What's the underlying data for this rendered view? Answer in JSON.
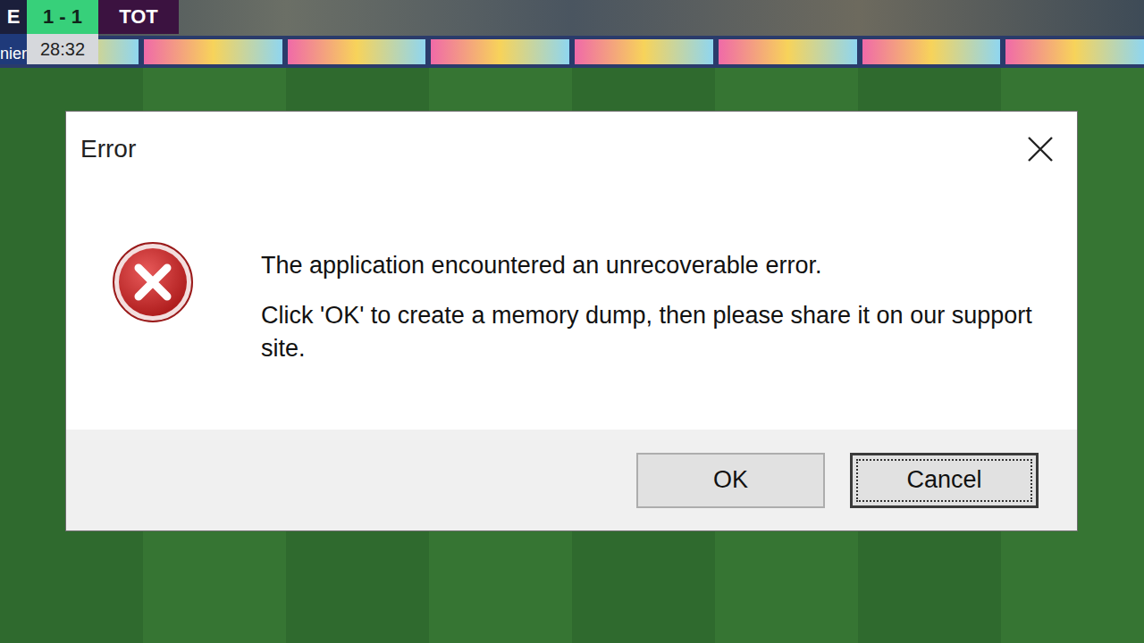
{
  "scoreboard": {
    "home": "E",
    "score": "1 - 1",
    "away": "TOT",
    "clock": "28:32",
    "ticker": "nier"
  },
  "dialog": {
    "title": "Error",
    "message": "The application encountered an unrecoverable error.",
    "detail": "Click 'OK' to create a memory dump, then please share it on our support site.",
    "buttons": [
      {
        "label": "OK",
        "focused": false
      },
      {
        "label": "Cancel",
        "focused": true
      }
    ]
  }
}
